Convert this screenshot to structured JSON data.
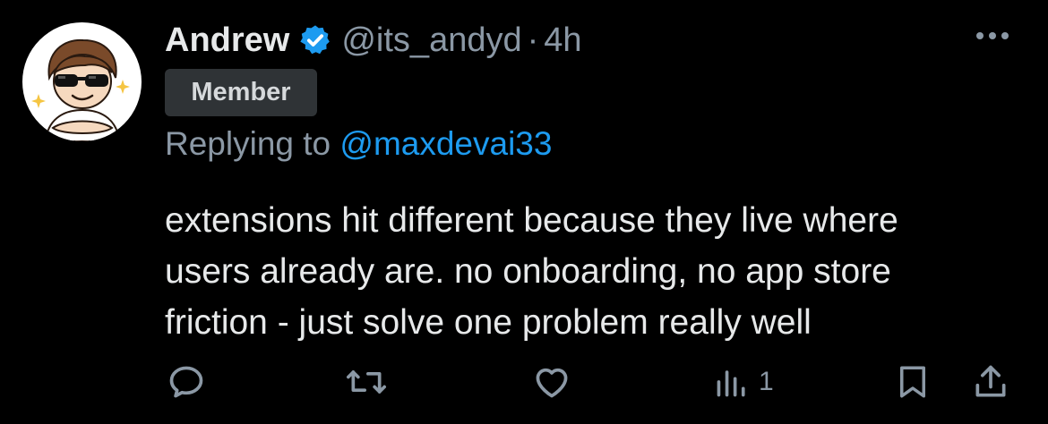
{
  "author": {
    "name": "Andrew",
    "handle": "@its_andyd",
    "separator": "·",
    "time": "4h",
    "verified": true,
    "badge": "Member",
    "avatar_icon": "cartoon-avatar-sunglasses"
  },
  "reply": {
    "prefix": "Replying to",
    "mention": "@maxdevai33"
  },
  "text": {
    "lines": [
      "extensions hit different because they live where",
      "users already are. no onboarding, no app store",
      "friction - just solve one problem really well"
    ]
  },
  "actions": {
    "reply_icon": "reply-icon",
    "retweet_icon": "retweet-icon",
    "like_icon": "heart-icon",
    "views_icon": "views-icon",
    "views_count": "1",
    "bookmark_icon": "bookmark-icon",
    "share_icon": "share-icon"
  },
  "colors": {
    "background": "#000000",
    "text": "#e7e9ea",
    "secondary": "#8b98a5",
    "accent": "#1d9bf0",
    "badge_bg": "#2f3336"
  }
}
